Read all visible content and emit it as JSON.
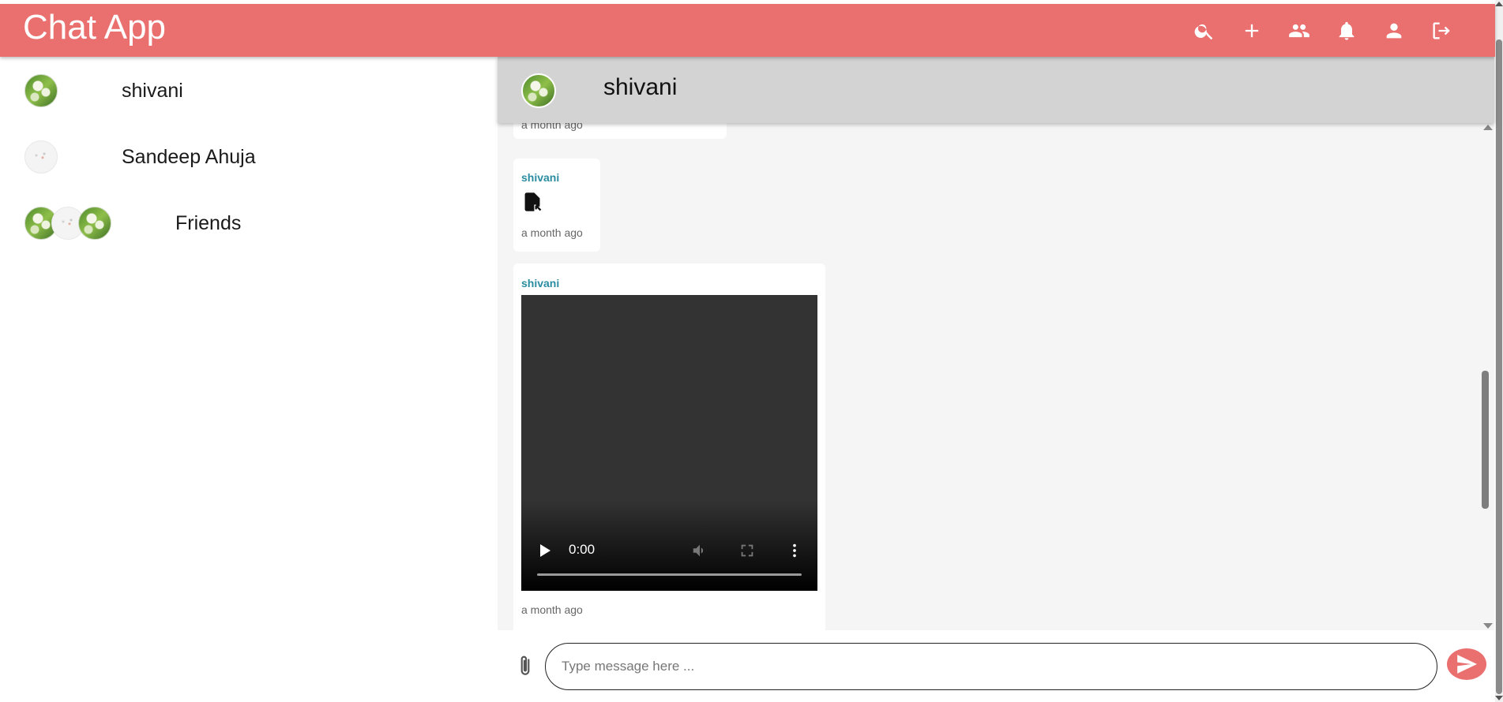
{
  "header": {
    "title": "Chat App",
    "icons": [
      "search-icon",
      "add-icon",
      "groups-icon",
      "notifications-icon",
      "profile-icon",
      "logout-icon"
    ]
  },
  "sidebar": {
    "chats": [
      {
        "name": "shivani",
        "avatar": "photo"
      },
      {
        "name": "Sandeep Ahuja",
        "avatar": "blank"
      },
      {
        "name": "Friends",
        "avatar": "group"
      }
    ]
  },
  "chat": {
    "header_name": "shivani",
    "messages": [
      {
        "time": "a month ago"
      },
      {
        "sender": "shivani",
        "type": "file",
        "time": "a month ago"
      },
      {
        "sender": "shivani",
        "type": "video",
        "video_time": "0:00",
        "time": "a month ago"
      }
    ]
  },
  "composer": {
    "placeholder": "Type message here ..."
  },
  "colors": {
    "brand": "#ea7070",
    "sender": "#2a8ca0",
    "chat_header": "#d3d3d3"
  }
}
